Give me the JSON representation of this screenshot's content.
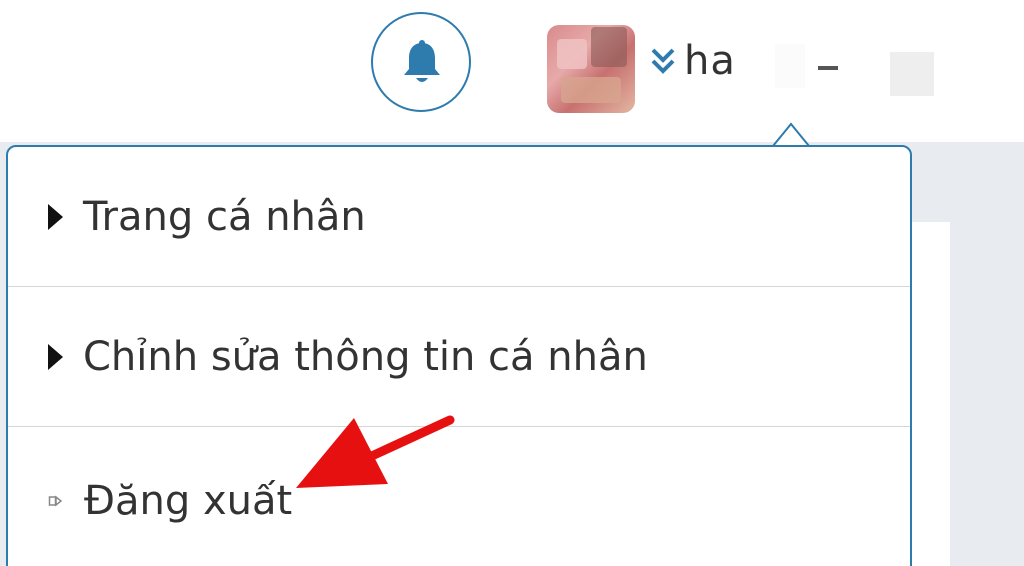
{
  "header": {
    "notification_icon": "bell-icon",
    "avatar_icon": "user-avatar",
    "toggle_icon": "double-chevron-down-icon",
    "username": "ha",
    "accent_color": "#2e7bae"
  },
  "dropdown": {
    "items": [
      {
        "label": "Trang cá nhân",
        "icon": "caret-right-icon"
      },
      {
        "label": "Chỉnh sửa thông tin cá nhân",
        "icon": "caret-right-icon"
      },
      {
        "label": "Đăng xuất",
        "icon": "logout-icon"
      }
    ]
  },
  "annotation": {
    "icon": "red-arrow",
    "color": "#e61010"
  }
}
